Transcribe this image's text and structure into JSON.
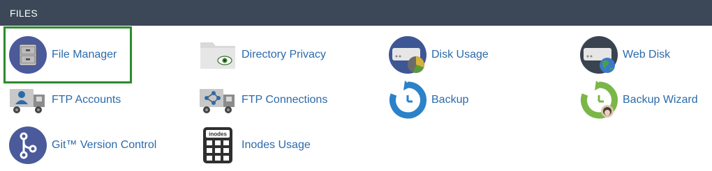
{
  "section": {
    "title": "FILES"
  },
  "items": [
    {
      "label": "File Manager",
      "icon": "file-manager-icon"
    },
    {
      "label": "Directory Privacy",
      "icon": "directory-privacy-icon"
    },
    {
      "label": "Disk Usage",
      "icon": "disk-usage-icon"
    },
    {
      "label": "Web Disk",
      "icon": "web-disk-icon"
    },
    {
      "label": "FTP Accounts",
      "icon": "ftp-accounts-icon"
    },
    {
      "label": "FTP Connections",
      "icon": "ftp-connections-icon"
    },
    {
      "label": "Backup",
      "icon": "backup-icon"
    },
    {
      "label": "Backup Wizard",
      "icon": "backup-wizard-icon"
    },
    {
      "label": "Git™ Version Control",
      "icon": "git-version-control-icon"
    },
    {
      "label": "Inodes Usage",
      "icon": "inodes-usage-icon"
    }
  ],
  "icon_text": {
    "inodes": "inodes"
  },
  "colors": {
    "header_bg": "#3c4858",
    "link": "#2b6aaa",
    "highlight_border": "#2e8b2e"
  }
}
